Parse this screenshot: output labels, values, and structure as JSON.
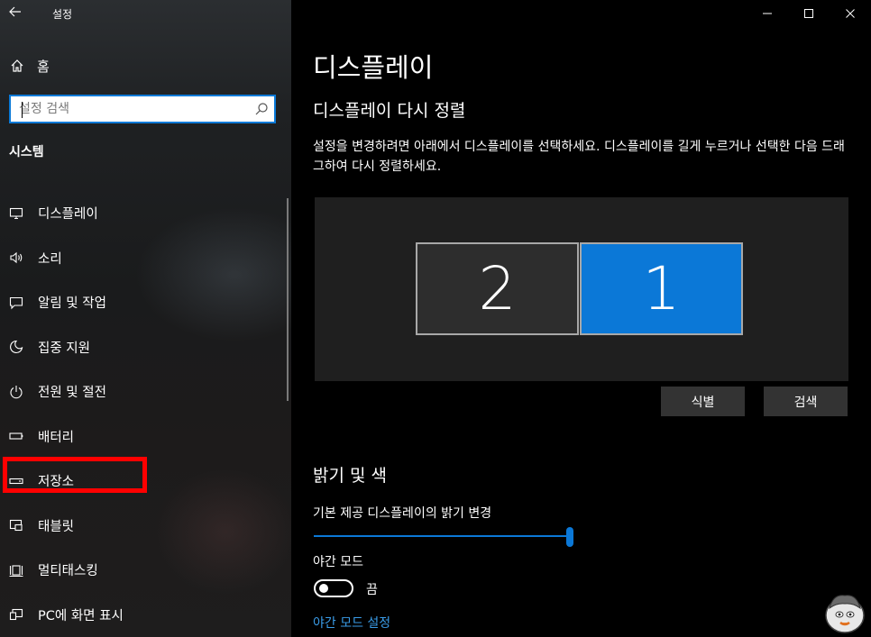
{
  "window": {
    "app_title": "설정",
    "back_icon": "back-arrow-icon",
    "controls": {
      "minimize": "—",
      "maximize": "☐",
      "close": "✕"
    }
  },
  "sidebar": {
    "home_label": "홈",
    "search_placeholder": "설정 검색",
    "section_label": "시스템",
    "items": [
      {
        "label": "디스플레이",
        "icon": "monitor-icon"
      },
      {
        "label": "소리",
        "icon": "speaker-icon"
      },
      {
        "label": "알림 및 작업",
        "icon": "notification-icon"
      },
      {
        "label": "집중 지원",
        "icon": "moon-icon"
      },
      {
        "label": "전원 및 절전",
        "icon": "power-icon"
      },
      {
        "label": "배터리",
        "icon": "battery-icon"
      },
      {
        "label": "저장소",
        "icon": "storage-icon"
      },
      {
        "label": "태블릿",
        "icon": "tablet-icon"
      },
      {
        "label": "멀티태스킹",
        "icon": "multitasking-icon"
      },
      {
        "label": "PC에 화면 표시",
        "icon": "project-icon"
      }
    ],
    "highlighted_item": "저장소"
  },
  "main": {
    "page_title": "디스플레이",
    "rearrange": {
      "title": "디스플레이 다시 정렬",
      "description": "설정을 변경하려면 아래에서 디스플레이를 선택하세요. 디스플레이를 길게 누르거나 선택한 다음 드래그하여 다시 정렬하세요.",
      "monitors": [
        {
          "number": "2",
          "selected": false
        },
        {
          "number": "1",
          "selected": true
        }
      ],
      "identify_button": "식별",
      "detect_button": "검색"
    },
    "brightness": {
      "title": "밝기 및 색",
      "brightness_label": "기본 제공 디스플레이의 밝기 변경",
      "brightness_value": 100,
      "night_light_label": "야간 모드",
      "night_light_state": "끔",
      "night_light_on": false,
      "night_light_settings_link": "야간 모드 설정"
    }
  },
  "colors": {
    "accent": "#0b78d7",
    "highlight_box": "#ff0000",
    "link": "#3a9ce8"
  }
}
